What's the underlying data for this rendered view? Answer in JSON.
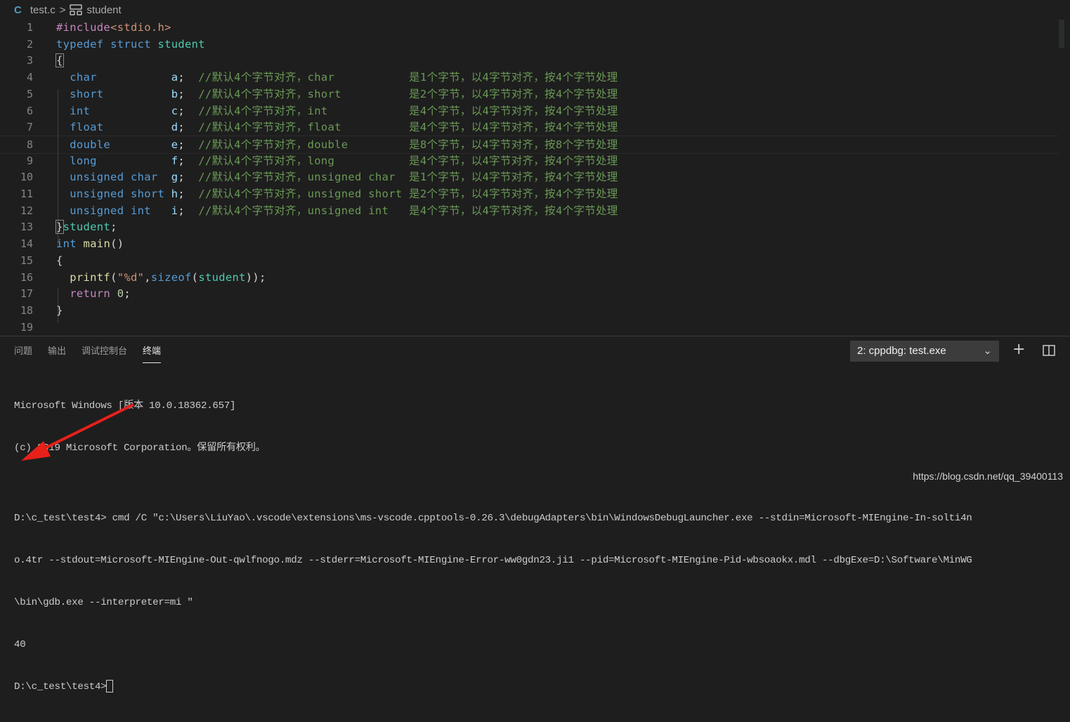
{
  "breadcrumb": {
    "lang_icon": "C",
    "file": "test.c",
    "separator": ">",
    "symbol_icon": "struct-icon",
    "symbol": "student"
  },
  "code_lines": [
    [
      [
        "#include",
        "pp"
      ],
      [
        "<stdio.h>",
        "inc"
      ]
    ],
    [
      [
        "typedef",
        "kw"
      ],
      [
        " ",
        "pl"
      ],
      [
        "struct",
        "kw"
      ],
      [
        " ",
        "pl"
      ],
      [
        "student",
        "ty"
      ]
    ],
    [
      [
        "{",
        "pl"
      ]
    ],
    [
      [
        "  ",
        "pl"
      ],
      [
        "char",
        "kw"
      ],
      [
        "           ",
        "pl"
      ],
      [
        "a",
        "var"
      ],
      [
        ";  ",
        "pl"
      ],
      [
        "//默认4个字节对齐，char           是1个字节，以4字节对齐，按4个字节处理",
        "cm"
      ]
    ],
    [
      [
        "  ",
        "pl"
      ],
      [
        "short",
        "kw"
      ],
      [
        "          ",
        "pl"
      ],
      [
        "b",
        "var"
      ],
      [
        ";  ",
        "pl"
      ],
      [
        "//默认4个字节对齐，short          是2个字节，以4字节对齐，按4个字节处理",
        "cm"
      ]
    ],
    [
      [
        "  ",
        "pl"
      ],
      [
        "int",
        "kw"
      ],
      [
        "            ",
        "pl"
      ],
      [
        "c",
        "var"
      ],
      [
        ";  ",
        "pl"
      ],
      [
        "//默认4个字节对齐，int            是4个字节，以4字节对齐，按4个字节处理",
        "cm"
      ]
    ],
    [
      [
        "  ",
        "pl"
      ],
      [
        "float",
        "kw"
      ],
      [
        "          ",
        "pl"
      ],
      [
        "d",
        "var"
      ],
      [
        ";  ",
        "pl"
      ],
      [
        "//默认4个字节对齐，float          是4个字节，以4字节对齐，按4个字节处理",
        "cm"
      ]
    ],
    [
      [
        "  ",
        "pl"
      ],
      [
        "double",
        "kw"
      ],
      [
        "         ",
        "pl"
      ],
      [
        "e",
        "var"
      ],
      [
        ";  ",
        "pl"
      ],
      [
        "//默认4个字节对齐，double         是8个字节，以4字节对齐，按8个字节处理",
        "cm"
      ]
    ],
    [
      [
        "  ",
        "pl"
      ],
      [
        "long",
        "kw"
      ],
      [
        "           ",
        "pl"
      ],
      [
        "f",
        "var"
      ],
      [
        ";  ",
        "pl"
      ],
      [
        "//默认4个字节对齐，long           是4个字节，以4字节对齐，按4个字节处理",
        "cm"
      ]
    ],
    [
      [
        "  ",
        "pl"
      ],
      [
        "unsigned char",
        "kw"
      ],
      [
        "  ",
        "pl"
      ],
      [
        "g",
        "var"
      ],
      [
        ";  ",
        "pl"
      ],
      [
        "//默认4个字节对齐，unsigned char  是1个字节，以4字节对齐，按4个字节处理",
        "cm"
      ]
    ],
    [
      [
        "  ",
        "pl"
      ],
      [
        "unsigned short",
        "kw"
      ],
      [
        " ",
        "pl"
      ],
      [
        "h",
        "var"
      ],
      [
        ";  ",
        "pl"
      ],
      [
        "//默认4个字节对齐，unsigned short 是2个字节，以4字节对齐，按4个字节处理",
        "cm"
      ]
    ],
    [
      [
        "  ",
        "pl"
      ],
      [
        "unsigned int",
        "kw"
      ],
      [
        "   ",
        "pl"
      ],
      [
        "i",
        "var"
      ],
      [
        ";  ",
        "pl"
      ],
      [
        "//默认4个字节对齐，unsigned int   是4个字节，以4字节对齐，按4个字节处理",
        "cm"
      ]
    ],
    [
      [
        "}",
        "pl"
      ],
      [
        "student",
        "ty"
      ],
      [
        ";",
        "pl"
      ]
    ],
    [
      [
        "int",
        "kw"
      ],
      [
        " ",
        "pl"
      ],
      [
        "main",
        "fn"
      ],
      [
        "()",
        "pl"
      ]
    ],
    [
      [
        "{",
        "pl"
      ]
    ],
    [
      [
        "  ",
        "pl"
      ],
      [
        "printf",
        "fn"
      ],
      [
        "(",
        "pl"
      ],
      [
        "\"%d\"",
        "str"
      ],
      [
        ",",
        "pl"
      ],
      [
        "sizeof",
        "kw"
      ],
      [
        "(",
        "pl"
      ],
      [
        "student",
        "ty"
      ],
      [
        "));",
        "pl"
      ]
    ],
    [
      [
        "  ",
        "pl"
      ],
      [
        "return",
        "pp"
      ],
      [
        " ",
        "pl"
      ],
      [
        "0",
        "num"
      ],
      [
        ";",
        "pl"
      ]
    ],
    [
      [
        "}",
        "pl"
      ]
    ],
    []
  ],
  "panel": {
    "tabs": [
      {
        "label": "问题"
      },
      {
        "label": "输出"
      },
      {
        "label": "调试控制台"
      },
      {
        "label": "终端",
        "active": true
      }
    ],
    "terminal_select": "2: cppdbg: test.exe",
    "add_icon": "plus-icon",
    "split_icon": "split-icon"
  },
  "terminal": {
    "lines": [
      "Microsoft Windows [版本 10.0.18362.657]",
      "(c) 2019 Microsoft Corporation。保留所有权利。",
      "",
      "D:\\c_test\\test4> cmd /C \"c:\\Users\\LiuYao\\.vscode\\extensions\\ms-vscode.cpptools-0.26.3\\debugAdapters\\bin\\WindowsDebugLauncher.exe --stdin=Microsoft-MIEngine-In-solti4n",
      "o.4tr --stdout=Microsoft-MIEngine-Out-qwlfnogo.mdz --stderr=Microsoft-MIEngine-Error-ww0gdn23.ji1 --pid=Microsoft-MIEngine-Pid-wbsoaokx.mdl --dbgExe=D:\\Software\\MinWG",
      "\\bin\\gdb.exe --interpreter=mi \"",
      "40"
    ],
    "prompt": "D:\\c_test\\test4>"
  },
  "watermark": "https://blog.csdn.net/qq_39400113",
  "colors": {
    "background": "#1e1e1e",
    "keyword": "#569cd6",
    "type": "#4ec9b0",
    "comment": "#6a9955",
    "arrow": "#e8201a"
  }
}
